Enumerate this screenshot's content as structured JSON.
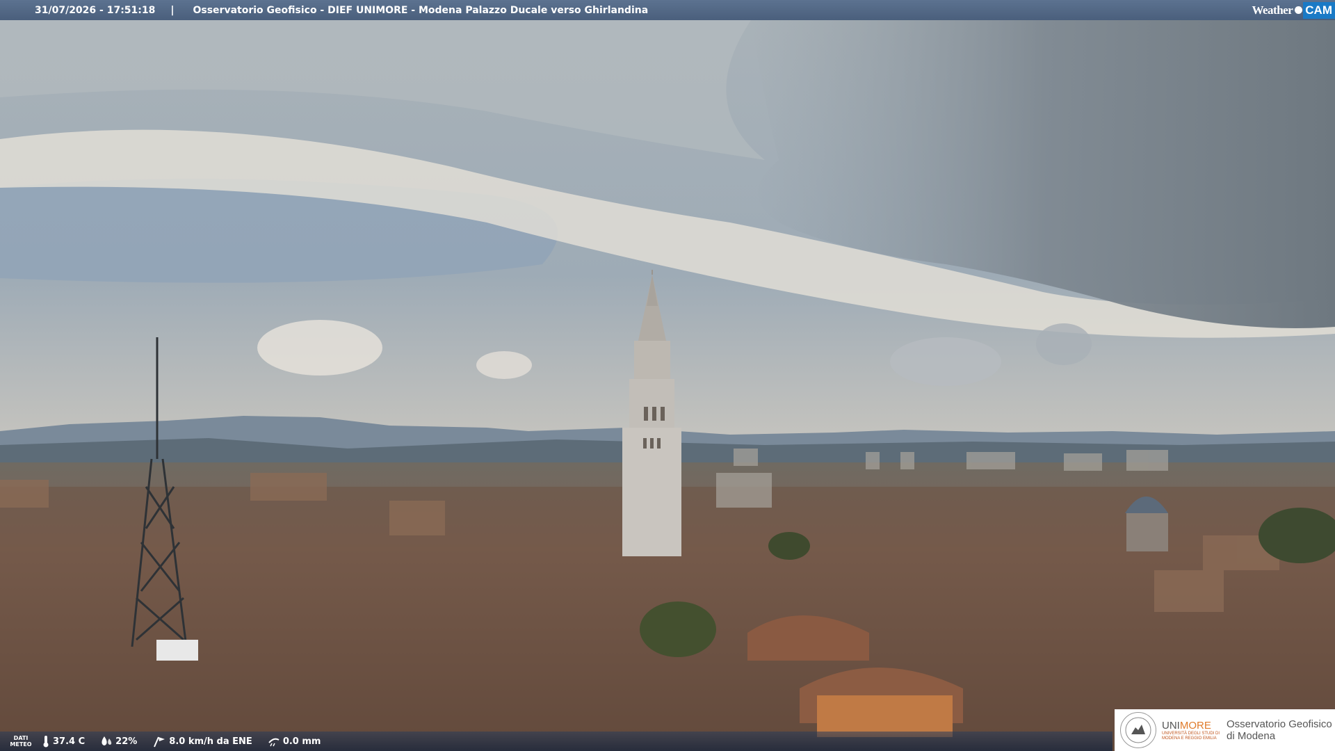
{
  "header": {
    "datetime": "31/07/2026 - 17:51:18",
    "separator": "|",
    "title": "Osservatorio Geofisico - DIEF UNIMORE - Modena Palazzo Ducale verso Ghirlandina",
    "brand_weather": "Weather",
    "brand_cam": "CAM"
  },
  "weather": {
    "label_line1": "DATI",
    "label_line2": "METEO",
    "temperature": "37.4 C",
    "humidity": "22%",
    "wind": "8.0 km/h da ENE",
    "rain": "0.0 mm"
  },
  "logo": {
    "uni_prefix": "UNI",
    "uni_suffix": "MORE",
    "uni_sub1": "UNIVERSITÀ DEGLI STUDI DI",
    "uni_sub2": "MODENA E REGGIO EMILIA",
    "obs_line1": "Osservatorio Geofisico",
    "obs_line2": "di Modena"
  },
  "colors": {
    "topbar": "#4a5f7c",
    "accent_cam": "#1a7ac6",
    "unimore_orange": "#e07b2a"
  },
  "icons": [
    "thermometer-icon",
    "humidity-drop-icon",
    "wind-icon",
    "rain-gauge-icon",
    "unimore-seal-icon"
  ]
}
